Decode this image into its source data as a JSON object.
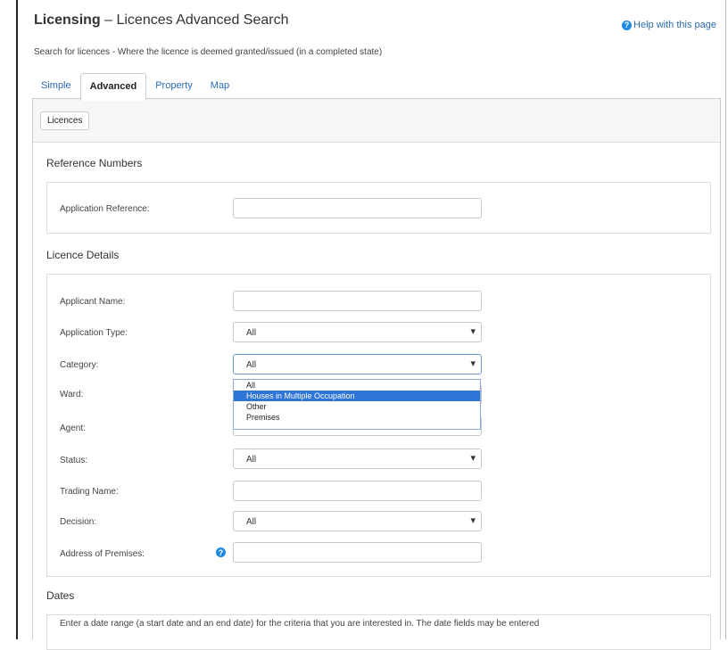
{
  "header": {
    "title_strong": "Licensing",
    "title_rest": " – Licences Advanced Search",
    "help_link": "Help with this page",
    "subtitle": "Search for licences - Where the licence is deemed granted/issued (in a completed state)"
  },
  "tabs": [
    {
      "label": "Simple",
      "active": false
    },
    {
      "label": "Advanced",
      "active": true
    },
    {
      "label": "Property",
      "active": false
    },
    {
      "label": "Map",
      "active": false
    }
  ],
  "panel": {
    "pill_label": "Licences"
  },
  "sections": {
    "reference": {
      "heading": "Reference Numbers",
      "application_reference": {
        "label": "Application Reference:",
        "value": ""
      }
    },
    "details": {
      "heading": "Licence Details",
      "applicant_name": {
        "label": "Applicant Name:",
        "value": ""
      },
      "application_type": {
        "label": "Application Type:",
        "value": "All"
      },
      "category": {
        "label": "Category:",
        "value": "All",
        "options": [
          "All",
          "Houses in Multiple Occupation",
          "Other",
          "Premises"
        ],
        "highlighted": "Houses in Multiple Occupation"
      },
      "ward": {
        "label": "Ward:"
      },
      "agent": {
        "label": "Agent:"
      },
      "status": {
        "label": "Status:",
        "value": "All"
      },
      "trading_name": {
        "label": "Trading Name:",
        "value": ""
      },
      "decision": {
        "label": "Decision:",
        "value": "All"
      },
      "address": {
        "label": "Address of Premises:",
        "value": ""
      }
    },
    "dates": {
      "heading": "Dates",
      "description": "Enter a date range (a start date and an end date) for the criteria that you are interested in. The date fields may be entered"
    }
  },
  "icons": {
    "help": "question-circle-icon",
    "dropdown": "chevron-down-icon"
  },
  "colors": {
    "link": "#2d6bb5",
    "highlight": "#2f74d6",
    "icon": "#1e88e5"
  }
}
